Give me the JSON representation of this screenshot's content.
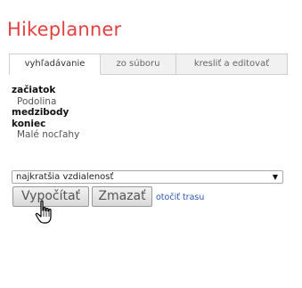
{
  "app": {
    "title": "Hikeplanner"
  },
  "tabs": [
    {
      "label": "vyhľadávanie",
      "active": true
    },
    {
      "label": "zo súboru",
      "active": false
    },
    {
      "label": "kresliť a editovať",
      "active": false
    }
  ],
  "route": {
    "start_label": "začiatok",
    "start_value": "Podolina",
    "via_label": "medzibody",
    "end_label": "koniec",
    "end_value": "Malé nocľahy"
  },
  "route_option": {
    "selected": "najkratšia vzdialenosť",
    "arrow": "▼"
  },
  "actions": {
    "calculate_label": "Vypočítať",
    "clear_label": "Zmazať",
    "reverse_link": "otočiť trasu"
  },
  "colors": {
    "title": "#e2413f",
    "link": "#2a55b8"
  },
  "cursor": {
    "icon": "hand-pointer-icon"
  }
}
